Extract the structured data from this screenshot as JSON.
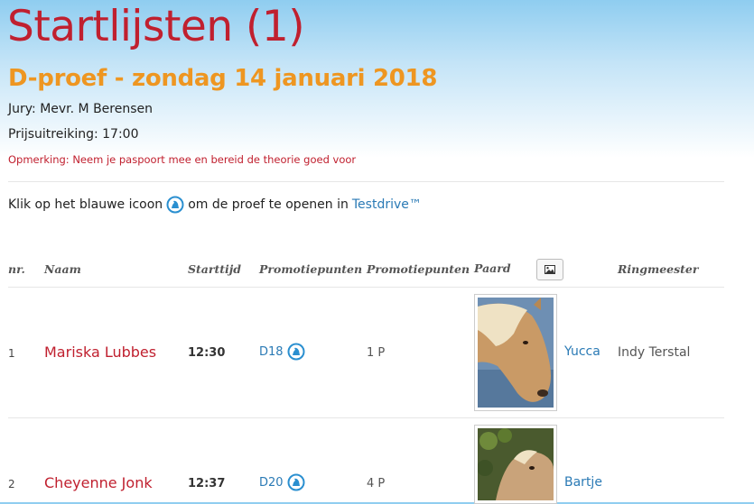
{
  "header": {
    "title": "Startlijsten (1)",
    "subtitle": "D-proef - zondag 14 januari 2018",
    "jury": "Jury: Mevr. M Berensen",
    "prijsuitreiking": "Prijsuitreiking: 17:00",
    "opmerking": "Opmerking: Neem je paspoort mee en bereid de theorie goed voor"
  },
  "instruction": {
    "before": "Klik op het blauwe icoon",
    "after": "om de proef te openen in",
    "link": "Testdrive™"
  },
  "table": {
    "columns": [
      "nr.",
      "Naam",
      "Starttijd",
      "Promotiepunten",
      "Promotiepunten",
      "Paard",
      "Ringmeester"
    ],
    "rows": [
      {
        "nr": "1",
        "naam": "Mariska Lubbes",
        "starttijd": "12:30",
        "proef": "D18",
        "punten": "1 P",
        "paard": "Yucca",
        "ringmeester": "Indy Terstal"
      },
      {
        "nr": "2",
        "naam": "Cheyenne Jonk",
        "starttijd": "12:37",
        "proef": "D20",
        "punten": "4 P",
        "paard": "Bartje",
        "ringmeester": ""
      }
    ]
  },
  "icons": {
    "testdrive": "testdrive-icon",
    "image": "image-icon"
  },
  "colors": {
    "title": "#c0202f",
    "subtitle": "#ee9621",
    "link": "#2a7ab5"
  }
}
